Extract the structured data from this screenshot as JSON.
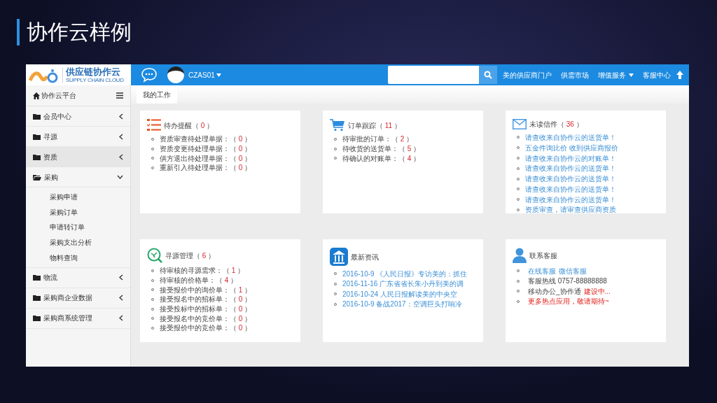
{
  "slide": {
    "title": "协作云样例"
  },
  "header": {
    "logo_title": "供应链协作云",
    "logo_subtitle": "SUPPLY CHAIN CLOUD",
    "user": "CZAS01",
    "nav": [
      {
        "label": "美的供应商门户",
        "dropdown": false
      },
      {
        "label": "供需市场",
        "dropdown": false
      },
      {
        "label": "增值服务",
        "dropdown": true
      },
      {
        "label": "客服中心",
        "dropdown": false
      }
    ]
  },
  "sidebar": {
    "title": "协作云平台",
    "items": [
      {
        "label": "会员中心",
        "expanded": false,
        "selected": false
      },
      {
        "label": "寻源",
        "expanded": false,
        "selected": false
      },
      {
        "label": "资质",
        "expanded": false,
        "selected": true
      },
      {
        "label": "采购",
        "expanded": true,
        "selected": false,
        "children": [
          {
            "label": "采购申请"
          },
          {
            "label": "采购订单"
          },
          {
            "label": "申请转订单"
          },
          {
            "label": "采购支出分析"
          },
          {
            "label": "物料查询"
          }
        ]
      },
      {
        "label": "物流",
        "expanded": false,
        "selected": false
      },
      {
        "label": "采购商企业数据",
        "expanded": false,
        "selected": false
      },
      {
        "label": "采购商系统管理",
        "expanded": false,
        "selected": false
      }
    ]
  },
  "tabs": [
    {
      "label": "我的工作",
      "selected": true
    }
  ],
  "cards": [
    {
      "kind": "todo",
      "title": "待办提醒",
      "count": "（ 0 ）",
      "items": [
        {
          "label": "资质审查待处理单据：",
          "count": "（ 0 ）"
        },
        {
          "label": "资质变更待处理单据：",
          "count": "（ 0 ）"
        },
        {
          "label": "供方退出待处理单据：",
          "count": "（ 0 ）"
        },
        {
          "label": "重新引入待处理单据：",
          "count": "（ 0 ）"
        }
      ]
    },
    {
      "kind": "orders",
      "title": "订单跟踪",
      "count": "（ 11 ）",
      "items": [
        {
          "label": "待审批的订单：",
          "count": "（ 2 ）"
        },
        {
          "label": "待收货的送货单：",
          "count": "（ 5 ）"
        },
        {
          "label": "待确认的对账单：",
          "count": "（ 4 ）"
        }
      ]
    },
    {
      "kind": "mail",
      "title": "未读信件",
      "count": "（ 36 ）",
      "links": [
        "请查收来自协作云的送货单！",
        "五金件询比价 收到供应商报价",
        "请查收来自协作云的对账单！",
        "请查收来自协作云的送货单！",
        "请查收来自协作云的送货单！",
        "请查收来自协作云的送货单！",
        "请查收来自协作云的送货单！",
        "资质审查，请审查供应商资质"
      ]
    },
    {
      "kind": "sourcing",
      "title": "寻源管理",
      "count": "（ 6 ）",
      "items": [
        {
          "label": "待审核的寻源需求：",
          "count": "（ 1 ）"
        },
        {
          "label": "待审核的价格单：",
          "count": "（ 4 ）"
        },
        {
          "label": "接受报价中的询价单：",
          "count": "（ 1 ）"
        },
        {
          "label": "接受报名中的招标单：",
          "count": "（ 0 ）"
        },
        {
          "label": "接受投标中的招标单：",
          "count": "（ 0 ）"
        },
        {
          "label": "接受报名中的竞价单：",
          "count": "（ 0 ）"
        },
        {
          "label": "接受报价中的竞价单：",
          "count": "（ 0 ）"
        }
      ]
    },
    {
      "kind": "news",
      "title": "最新资讯",
      "links": [
        "2016-10-9 《人民日报》专访美的：抓住",
        "2016-11-16 广东省省长朱小丹到美的调",
        "2016-10-24 人民日报解读美的中央空",
        "2016-10-9 备战2017：空调巨头打响冷"
      ]
    },
    {
      "kind": "contact",
      "title": "联系客服",
      "lines": [
        [
          {
            "text": "在线客服",
            "kind": "link"
          },
          {
            "text": "微信客服",
            "kind": "link"
          }
        ],
        [
          {
            "text": "客服热线 0757-88888888",
            "kind": "plain"
          }
        ],
        [
          {
            "text": "移动办公_协作通",
            "kind": "plain"
          },
          {
            "text": "建设中...",
            "kind": "alert"
          }
        ],
        [
          {
            "text": "更多热点应用，敬请期待~",
            "kind": "alert"
          }
        ]
      ]
    }
  ]
}
